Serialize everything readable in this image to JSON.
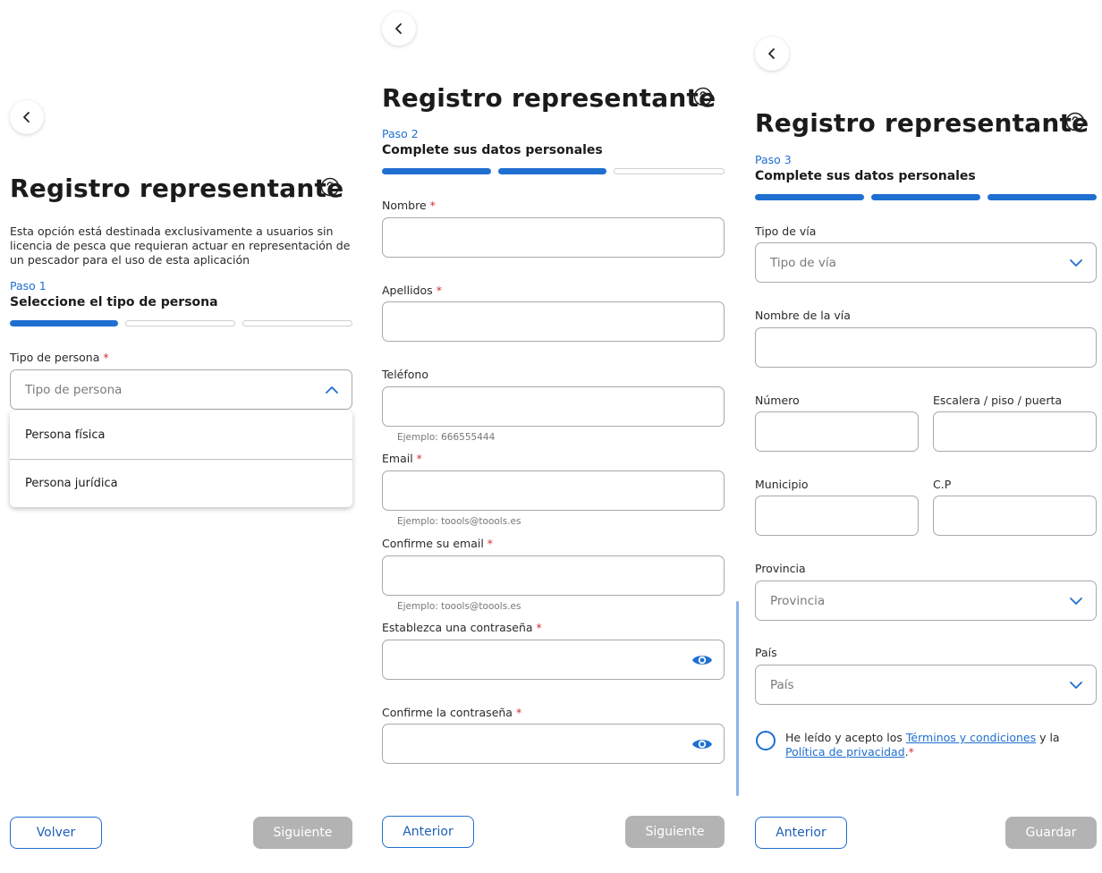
{
  "colors": {
    "accent": "#1f6fd1",
    "required": "#d32f2f",
    "disabled_button": "#b3b3b3"
  },
  "icons": {
    "back": "chevron-left-icon",
    "help": "question-circle-icon",
    "dropdown_open": "chevron-up-icon",
    "dropdown_closed": "chevron-down-icon",
    "password": "eye-icon"
  },
  "screen1": {
    "title": "Registro representante",
    "description": "Esta opción está destinada exclusivamente a usuarios sin licencia de pesca que requieran actuar en representación de un pescador para el uso de esta aplicación",
    "step_label": "Paso 1",
    "step_title": "Seleccione el tipo de persona",
    "progress": {
      "current": 1,
      "total": 3
    },
    "tipo_label": "Tipo de persona",
    "required_mark": "*",
    "tipo_placeholder": "Tipo de persona",
    "options": [
      "Persona física",
      "Persona jurídica"
    ],
    "back_button": "Volver",
    "next_button": "Siguiente"
  },
  "screen2": {
    "title": "Registro representante",
    "step_label": "Paso 2",
    "step_title": "Complete sus datos personales",
    "progress": {
      "current": 2,
      "total": 3
    },
    "required_mark": "*",
    "nombre_label": "Nombre",
    "apellidos_label": "Apellidos",
    "telefono_label": "Teléfono",
    "telefono_hint": "Ejemplo: 666555444",
    "email_label": "Email",
    "email_hint": "Ejemplo: toools@toools.es",
    "confirm_email_label": "Confirme su email",
    "confirm_email_hint": "Ejemplo: toools@toools.es",
    "password_label": "Establezca una contraseña",
    "confirm_password_label": "Confirme la contraseña",
    "prev_button": "Anterior",
    "next_button": "Siguiente"
  },
  "screen3": {
    "title": "Registro representante",
    "step_label": "Paso 3",
    "step_title": "Complete sus datos personales",
    "progress": {
      "current": 3,
      "total": 3
    },
    "tipo_via_label": "Tipo de vía",
    "tipo_via_placeholder": "Tipo de vía",
    "nombre_via_label": "Nombre de la vía",
    "numero_label": "Número",
    "escalera_label": "Escalera / piso / puerta",
    "municipio_label": "Municipio",
    "cp_label": "C.P",
    "provincia_label": "Provincia",
    "provincia_placeholder": "Provincia",
    "pais_label": "País",
    "pais_placeholder": "País",
    "terms_prefix": "He leído y acepto los ",
    "terms_link": "Términos y condiciones",
    "terms_middle": " y la ",
    "privacy_link": "Política de privacidad",
    "terms_suffix": ".",
    "required_mark": "*",
    "prev_button": "Anterior",
    "save_button": "Guardar"
  }
}
